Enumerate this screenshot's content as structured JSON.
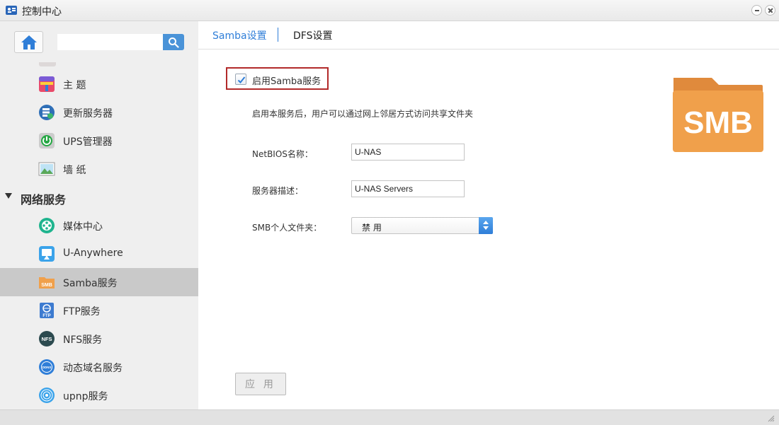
{
  "window": {
    "title": "控制中心"
  },
  "sidebar": {
    "search": {
      "value": "",
      "placeholder": ""
    },
    "items": [
      {
        "label": "主 题",
        "icon": "theme-icon"
      },
      {
        "label": "更新服务器",
        "icon": "update-server-icon"
      },
      {
        "label": "UPS管理器",
        "icon": "ups-icon"
      },
      {
        "label": "墙 纸",
        "icon": "wallpaper-icon"
      }
    ],
    "section": {
      "label": "网络服务"
    },
    "network_items": [
      {
        "label": "媒体中心",
        "icon": "media-center-icon"
      },
      {
        "label": "U-Anywhere",
        "icon": "u-anywhere-icon"
      },
      {
        "label": "Samba服务",
        "icon": "samba-icon",
        "active": true
      },
      {
        "label": "FTP服务",
        "icon": "ftp-icon"
      },
      {
        "label": "NFS服务",
        "icon": "nfs-icon"
      },
      {
        "label": "动态域名服务",
        "icon": "ddns-icon"
      },
      {
        "label": "upnp服务",
        "icon": "upnp-icon"
      }
    ]
  },
  "main": {
    "tabs": [
      {
        "label": "Samba设置",
        "active": true
      },
      {
        "label": "DFS设置",
        "active": false
      }
    ],
    "enable": {
      "label": "启用Samba服务",
      "checked": true
    },
    "description": "启用本服务后，用户可以通过网上邻居方式访问共享文件夹",
    "form": {
      "netbios": {
        "label": "NetBIOS名称：",
        "value": "U-NAS"
      },
      "server_desc": {
        "label": "服务器描述：",
        "value": "U-NAS Servers"
      },
      "smb_home": {
        "label": "SMB个人文件夹：",
        "value": "禁 用"
      }
    },
    "logo_text": "SMB",
    "apply_label": "应 用"
  },
  "colors": {
    "accent": "#2f7ed8",
    "highlight_border": "#b22a2a",
    "smb_orange": "#f0a04b"
  }
}
